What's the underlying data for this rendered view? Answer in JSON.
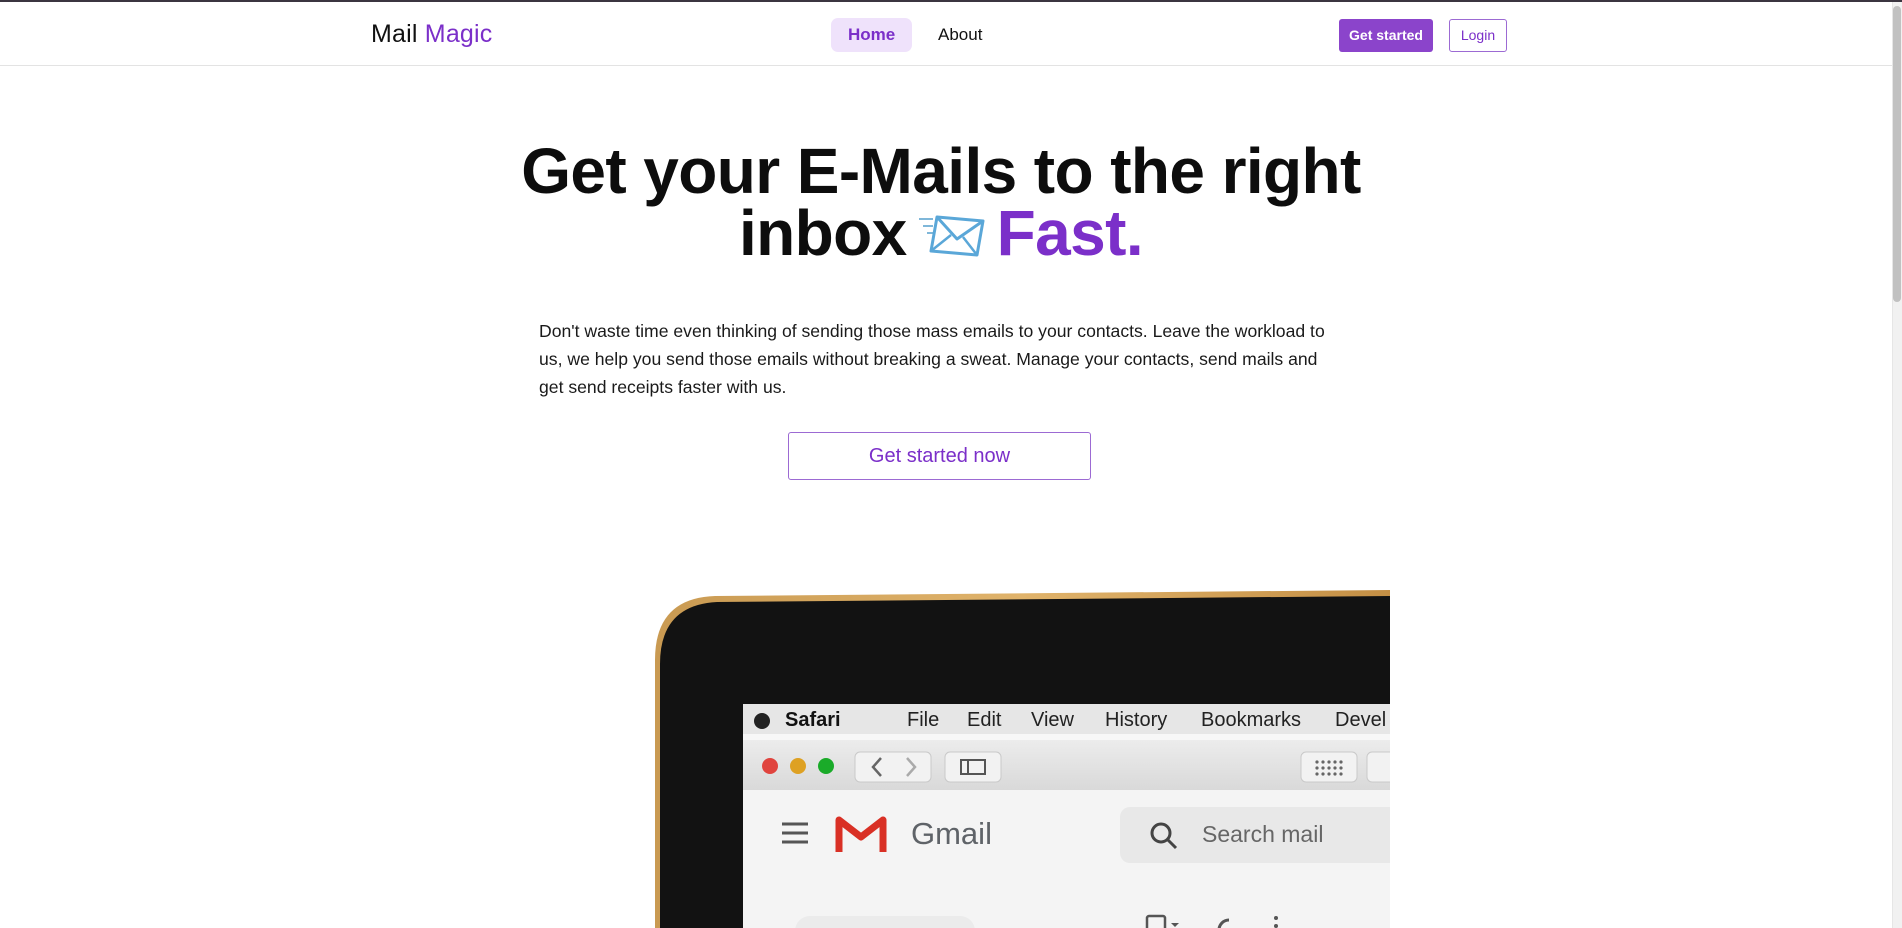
{
  "header": {
    "brand_main": "Mail",
    "brand_accent": "Magic",
    "nav": [
      {
        "label": "Home",
        "active": true
      },
      {
        "label": "About",
        "active": false
      }
    ],
    "get_started_label": "Get started",
    "login_label": "Login"
  },
  "hero": {
    "title_line1": "Get your E-Mails to the right",
    "title_line2_start": "inbox",
    "title_accent": "Fast.",
    "description": "Don't waste time even thinking of sending those mass emails to your contacts. Leave the workload to us, we help you send those emails without breaking a sweat. Manage your contacts, send mails and get send receipts faster with us.",
    "cta_label": "Get started now"
  },
  "photo": {
    "menu": [
      "Safari",
      "File",
      "Edit",
      "View",
      "History",
      "Bookmarks",
      "Devel"
    ],
    "app_name": "Gmail",
    "search_placeholder": "Search mail"
  },
  "colors": {
    "accent": "#7b2fc9",
    "button_bg": "#8b44cb",
    "nav_active_bg": "#efe2fb"
  },
  "icons": {
    "envelope": "incoming-envelope-icon"
  }
}
